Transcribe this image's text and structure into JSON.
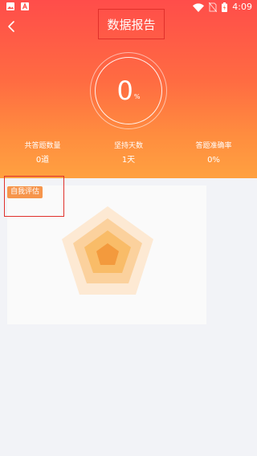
{
  "status_bar": {
    "time": "4:09",
    "left_icons": [
      "image-icon",
      "text-a-icon"
    ],
    "right_icons": [
      "wifi-icon",
      "no-sim-icon",
      "battery-charging-icon"
    ]
  },
  "header": {
    "title": "数据报告",
    "back_icon": "chevron-left-icon",
    "score_value": "0",
    "score_unit": "%",
    "stats": [
      {
        "label": "共答题数量",
        "value": "0道"
      },
      {
        "label": "坚持天数",
        "value": "1天"
      },
      {
        "label": "答题准确率",
        "value": "0%"
      }
    ]
  },
  "assessment": {
    "tag": "自我评估",
    "radar_colors": [
      "#fde9d3",
      "#fbd19d",
      "#f9bc68",
      "#f39a3d"
    ]
  },
  "colors": {
    "header_gradient": [
      "#ff4d4a",
      "#ffa140"
    ],
    "page_background": "#f2f3f7",
    "tag_background": "#f6954c",
    "highlight_border": "#e0302b"
  }
}
